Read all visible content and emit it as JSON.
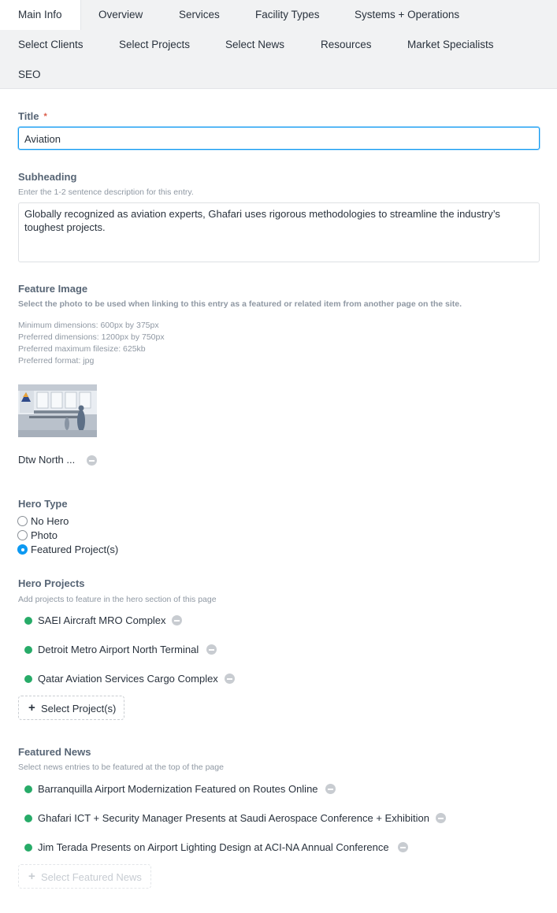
{
  "tabs": [
    {
      "label": "Main Info",
      "active": true
    },
    {
      "label": "Overview"
    },
    {
      "label": "Services"
    },
    {
      "label": "Facility Types"
    },
    {
      "label": "Systems + Operations"
    },
    {
      "label": "Select Clients"
    },
    {
      "label": "Select Projects"
    },
    {
      "label": "Select News"
    },
    {
      "label": "Resources"
    },
    {
      "label": "Market Specialists"
    },
    {
      "label": "SEO"
    }
  ],
  "title_field": {
    "label": "Title",
    "required_mark": "*",
    "value": "Aviation"
  },
  "subheading_field": {
    "label": "Subheading",
    "hint": "Enter the 1-2 sentence description for this entry.",
    "value": "Globally recognized as aviation experts, Ghafari uses rigorous methodologies to streamline the industry’s toughest projects."
  },
  "feature_image": {
    "label": "Feature Image",
    "hint": "Select the photo to be used when linking to this entry as a featured or related item from another page on the site.",
    "specs": [
      "Minimum dimensions: 600px by 375px",
      "Preferred dimensions: 1200px by 750px",
      "Preferred maximum filesize: 625kb",
      "Preferred format: jpg"
    ],
    "asset_name": "Dtw North ..."
  },
  "hero_type": {
    "label": "Hero Type",
    "options": [
      "No Hero",
      "Photo",
      "Featured Project(s)"
    ],
    "selected": "Featured Project(s)"
  },
  "hero_projects": {
    "label": "Hero Projects",
    "hint": "Add projects to feature in the hero section of this page",
    "items": [
      "SAEI Aircraft MRO Complex",
      "Detroit Metro Airport North Terminal",
      "Qatar Aviation Services Cargo Complex"
    ],
    "button_label": "Select Project(s)"
  },
  "featured_news": {
    "label": "Featured News",
    "hint": "Select news entries to be featured at the top of the page",
    "items": [
      "Barranquilla Airport Modernization Featured on Routes Online",
      "Ghafari ICT + Security Manager Presents at Saudi Aerospace Conference + Exhibition",
      "Jim Terada Presents on Airport Lighting Design at ACI-NA Annual Conference"
    ],
    "button_label": "Select Featured News"
  },
  "colors": {
    "accent": "#0d99f2",
    "status_enabled": "#27ab68",
    "required": "#da5a47"
  },
  "icons": {
    "remove": "remove-circle-icon",
    "status": "status-dot-icon",
    "add": "plus-icon"
  }
}
